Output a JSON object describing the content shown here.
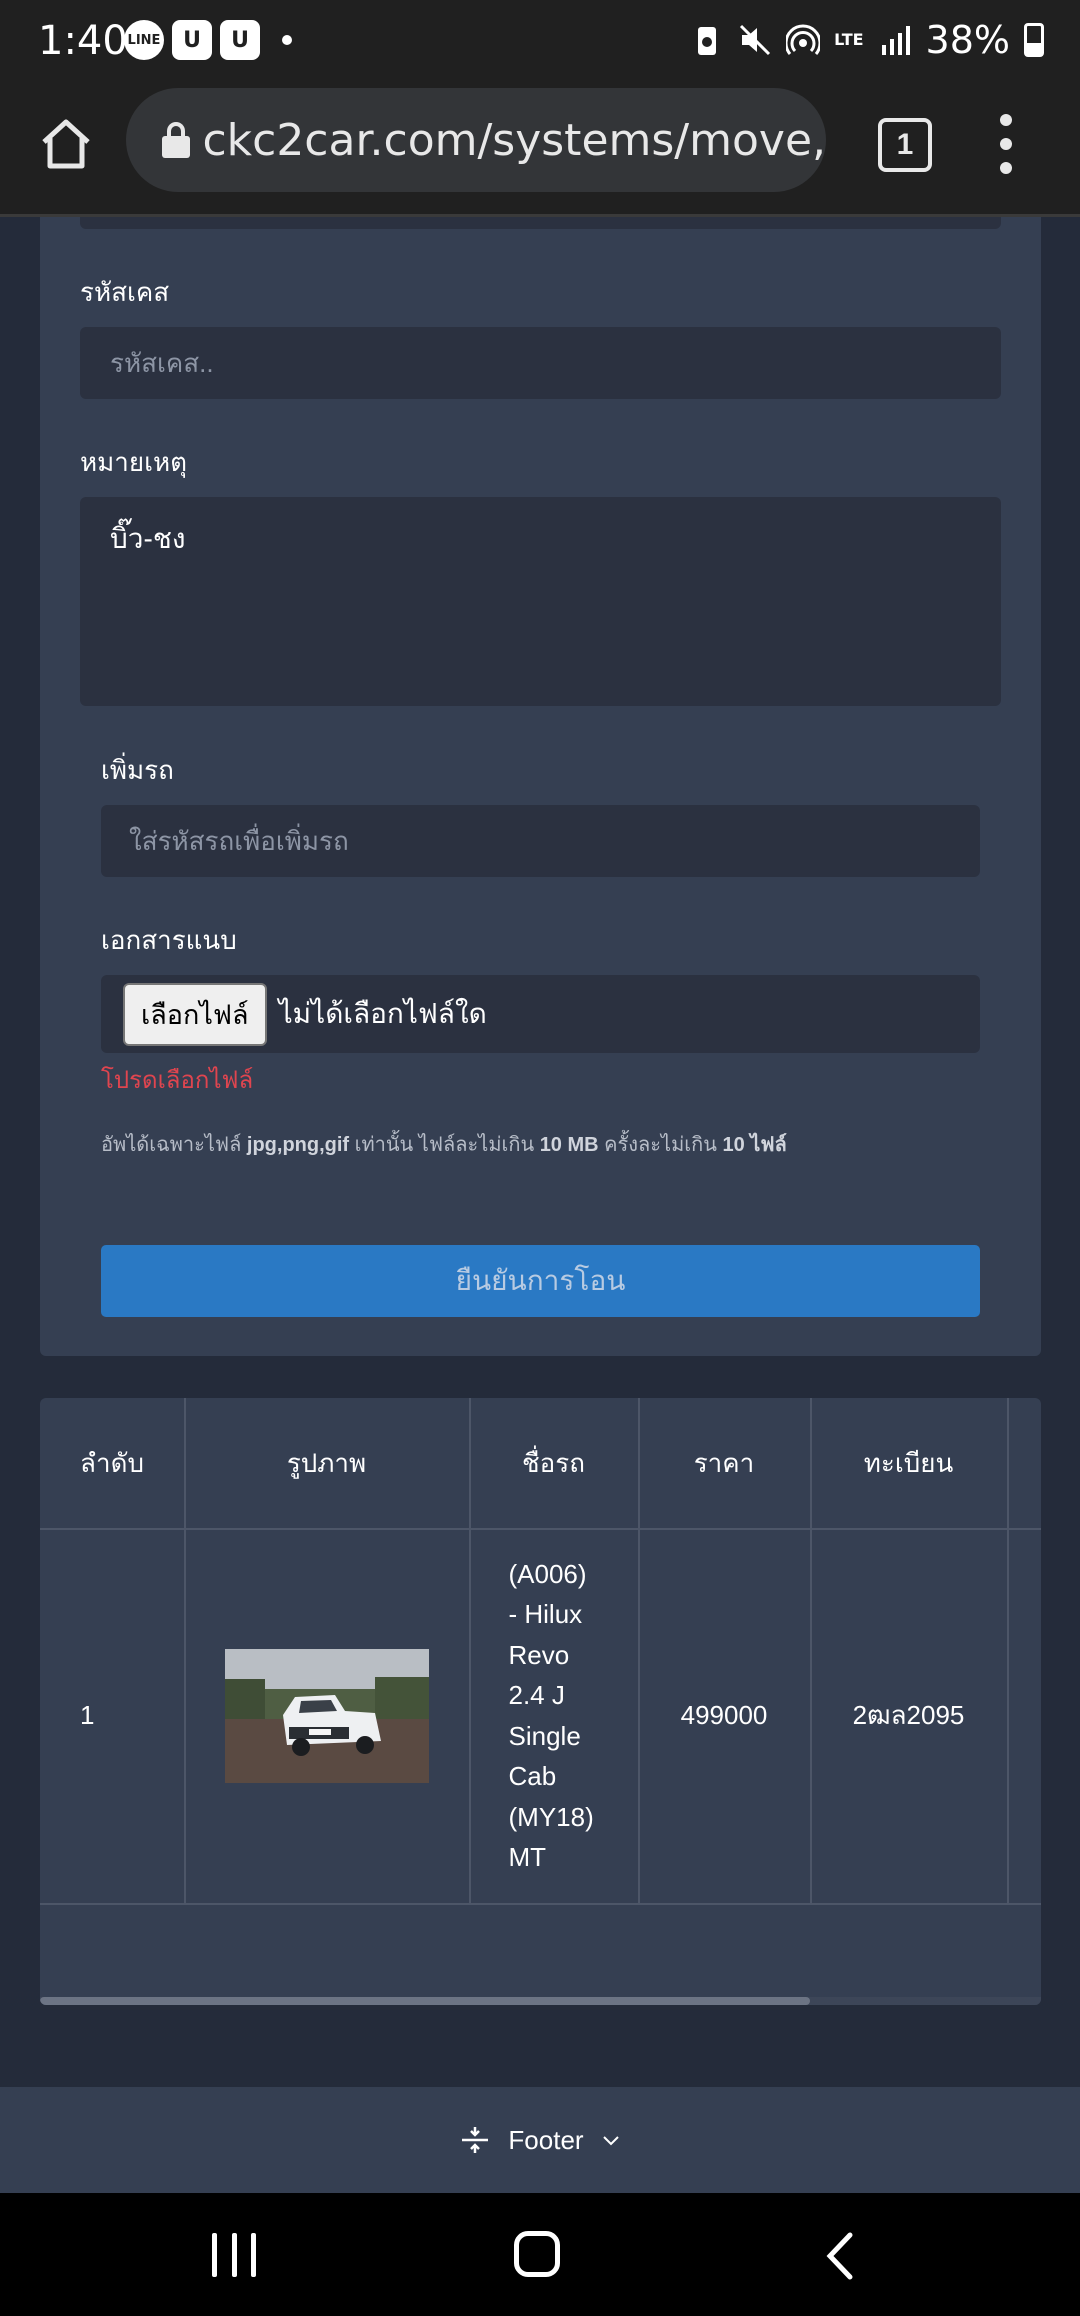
{
  "status_bar": {
    "time": "1:40",
    "notif_line": "LINE",
    "notif_u1": "U",
    "notif_u2": "U",
    "lte": "LTE",
    "battery": "38%"
  },
  "browser": {
    "url": "ckc2car.com/systems/move,",
    "tab_count": "1"
  },
  "form": {
    "case_code_label": "รหัสเคส",
    "case_code_placeholder": "รหัสเคส..",
    "remark_label": "หมายเหตุ",
    "remark_value": "บิ๊ว-ชง",
    "add_car_label": "เพิ่มรถ",
    "add_car_placeholder": "ใส่รหัสรถเพื่อเพิ่มรถ",
    "attachment_label": "เอกสารแนบ",
    "choose_file_button": "เลือกไฟล์",
    "no_file_text": "ไม่ได้เลือกไฟล์ใด",
    "error_text": "โปรดเลือกไฟล์",
    "help_prefix": "อัพได้เฉพาะไฟล์ ",
    "help_types": "jpg,png,gif",
    "help_mid1": " เท่านั้น ไฟล์ละไม่เกิน ",
    "help_size": "10 MB",
    "help_mid2": " ครั้งละไม่เกิน ",
    "help_count": "10 ไฟล์",
    "submit_button": "ยืนยันการโอน"
  },
  "table": {
    "headers": [
      "ลำดับ",
      "รูปภาพ",
      "ชื่อรถ",
      "ราคา",
      "ทะเบียน"
    ],
    "rows": [
      {
        "index": "1",
        "car_name_lines": [
          "(A006)",
          "- Hilux",
          "Revo",
          "2.4 J",
          "Single",
          "Cab",
          "(MY18)",
          "MT"
        ],
        "price": "499000",
        "plate": "2ฒล2095"
      }
    ]
  },
  "footer": {
    "label": "Footer"
  },
  "colors": {
    "page_bg": "#242b3a",
    "card_bg": "#353f52",
    "input_bg": "#2b3140",
    "primary": "#2a79c4",
    "error": "#e0454f"
  }
}
